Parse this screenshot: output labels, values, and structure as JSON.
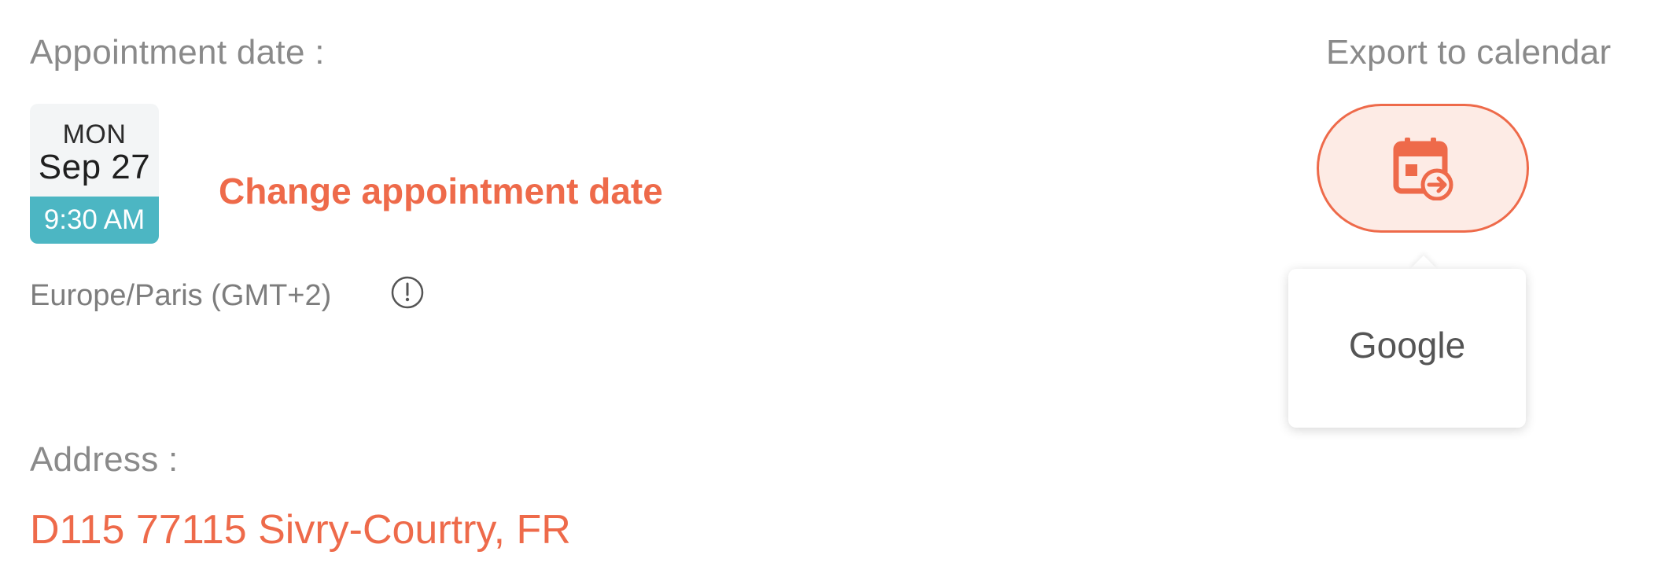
{
  "appointment": {
    "date_label": "Appointment date :",
    "weekday": "MON",
    "month_day": "Sep 27",
    "time": "9:30 AM",
    "change_link": "Change appointment date",
    "timezone": "Europe/Paris (GMT+2)"
  },
  "address": {
    "label": "Address :",
    "value": "D115 77115 Sivry-Courtry, FR"
  },
  "export": {
    "label": "Export to calendar",
    "button_icon": "calendar-export-icon",
    "menu_items": [
      "Google"
    ]
  },
  "colors": {
    "accent": "#ee6a4a",
    "accent_bg": "#fdebe5",
    "time_badge": "#4cb6c3",
    "muted_text": "#8a8a8a"
  }
}
